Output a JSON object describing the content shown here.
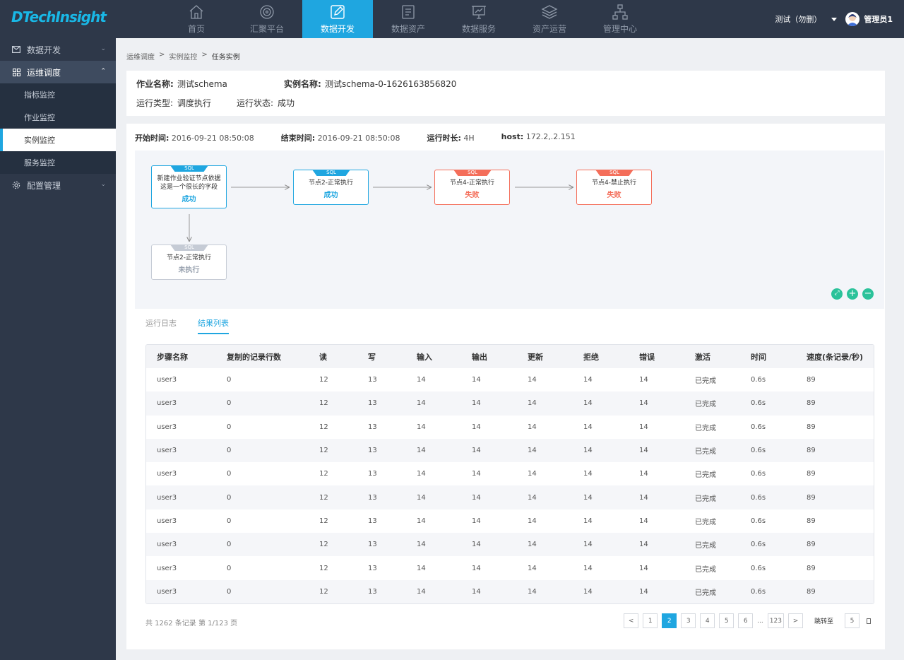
{
  "app": {
    "logo": "DTechInsight"
  },
  "nav": [
    {
      "label": "首页",
      "icon": "home-icon"
    },
    {
      "label": "汇聚平台",
      "icon": "aggregation-icon"
    },
    {
      "label": "数据开发",
      "icon": "edit-icon"
    },
    {
      "label": "数据资产",
      "icon": "asset-icon"
    },
    {
      "label": "数据服务",
      "icon": "service-icon"
    },
    {
      "label": "资产运营",
      "icon": "layers-icon"
    },
    {
      "label": "管理中心",
      "icon": "org-icon"
    }
  ],
  "user": {
    "tenant": "测试（勿删）",
    "name": "管理员1"
  },
  "sidebar": {
    "groups": [
      {
        "label": "数据开发",
        "icon": "mail-icon"
      },
      {
        "label": "运维调度",
        "icon": "grid-icon"
      },
      {
        "label": "配置管理",
        "icon": "gear-icon"
      }
    ],
    "subitems": [
      "指标监控",
      "作业监控",
      "实例监控",
      "服务监控"
    ]
  },
  "breadcrumb": [
    "运维调度",
    ">",
    "实例监控",
    ">",
    "任务实例"
  ],
  "info": {
    "job_name_label": "作业名称:",
    "job_name": "测试schema",
    "instance_name_label": "实例名称:",
    "instance_name": "测试schema-0-1626163856820",
    "run_type_label": "运行类型:",
    "run_type": "调度执行",
    "run_status_label": "运行状态:",
    "run_status": "成功"
  },
  "timing": {
    "start_label": "开始时间:",
    "start": "2016-09-21  08:50:08",
    "end_label": "结束时间:",
    "end": "2016-09-21  08:50:08",
    "duration_label": "运行时长:",
    "duration": "4H",
    "host_label": "host:",
    "host": "172.2,.2.151"
  },
  "dag": {
    "nodes": [
      {
        "tag": "SQL",
        "title1": "新建作业验证节点依据",
        "title2": "这是一个很长的字段",
        "status": "成功"
      },
      {
        "tag": "SQL",
        "title1": "节点2-正常执行",
        "title2": "",
        "status": "成功"
      },
      {
        "tag": "SQL",
        "title1": "节点4-正常执行",
        "title2": "",
        "status": "失败"
      },
      {
        "tag": "SQL",
        "title1": "节点4-禁止执行",
        "title2": "",
        "status": "失败"
      },
      {
        "tag": "SQL",
        "title1": "节点2-正常执行",
        "title2": "",
        "status": "未执行"
      }
    ]
  },
  "tabs": [
    "运行日志",
    "结果列表"
  ],
  "table": {
    "headers": [
      "步骤名称",
      "复制的记录行数",
      "读",
      "写",
      "输入",
      "输出",
      "更新",
      "拒绝",
      "错误",
      "激活",
      "时间",
      "速度(条记录/秒)"
    ],
    "rows": [
      [
        "user3",
        "0",
        "12",
        "13",
        "14",
        "14",
        "14",
        "14",
        "14",
        "已完成",
        "0.6s",
        "89"
      ],
      [
        "user3",
        "0",
        "12",
        "13",
        "14",
        "14",
        "14",
        "14",
        "14",
        "已完成",
        "0.6s",
        "89"
      ],
      [
        "user3",
        "0",
        "12",
        "13",
        "14",
        "14",
        "14",
        "14",
        "14",
        "已完成",
        "0.6s",
        "89"
      ],
      [
        "user3",
        "0",
        "12",
        "13",
        "14",
        "14",
        "14",
        "14",
        "14",
        "已完成",
        "0.6s",
        "89"
      ],
      [
        "user3",
        "0",
        "12",
        "13",
        "14",
        "14",
        "14",
        "14",
        "14",
        "已完成",
        "0.6s",
        "89"
      ],
      [
        "user3",
        "0",
        "12",
        "13",
        "14",
        "14",
        "14",
        "14",
        "14",
        "已完成",
        "0.6s",
        "89"
      ],
      [
        "user3",
        "0",
        "12",
        "13",
        "14",
        "14",
        "14",
        "14",
        "14",
        "已完成",
        "0.6s",
        "89"
      ],
      [
        "user3",
        "0",
        "12",
        "13",
        "14",
        "14",
        "14",
        "14",
        "14",
        "已完成",
        "0.6s",
        "89"
      ],
      [
        "user3",
        "0",
        "12",
        "13",
        "14",
        "14",
        "14",
        "14",
        "14",
        "已完成",
        "0.6s",
        "89"
      ],
      [
        "user3",
        "0",
        "12",
        "13",
        "14",
        "14",
        "14",
        "14",
        "14",
        "已完成",
        "0.6s",
        "89"
      ]
    ]
  },
  "pagination": {
    "total_text": "共 1262 条记录 第 1/123 页",
    "pages": [
      "1",
      "2",
      "3",
      "4",
      "5",
      "6"
    ],
    "ellipsis": "...",
    "last": "123",
    "prev": "<",
    "next": ">",
    "jump_label": "跳转至",
    "jump_value": "5"
  }
}
